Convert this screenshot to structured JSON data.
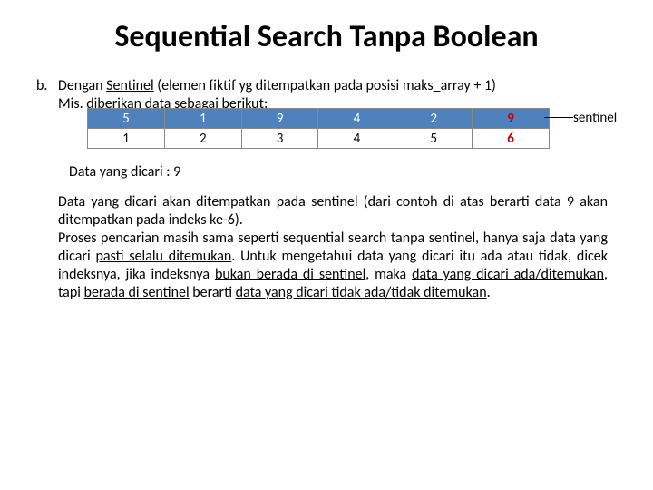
{
  "title": "Sequential Search Tanpa Boolean",
  "list_marker": "b.",
  "intro_prefix": "Dengan ",
  "intro_sentinel": "Sentinel",
  "intro_rest": " (elemen fiktif yg ditempatkan pada posisi maks_array + 1)",
  "intro_line2": "Mis. diberikan data sebagai berikut:",
  "table": {
    "data": [
      "5",
      "1",
      "9",
      "4",
      "2",
      "9"
    ],
    "index": [
      "1",
      "2",
      "3",
      "4",
      "5",
      "6"
    ]
  },
  "sentinel_label": "sentinel",
  "search_label": "Data yang dicari : 9",
  "para1_a": "Data yang dicari akan ditempatkan pada sentinel (dari contoh di atas berarti data 9 akan ditempatkan pada indeks ke-6).",
  "para2_a": "Proses pencarian masih sama seperti sequential search tanpa sentinel, hanya saja data yang dicari ",
  "para2_b": "pasti selalu ditemukan",
  "para2_c": ". Untuk mengetahui data yang dicari itu ada atau tidak, dicek indeksnya, jika indeksnya ",
  "para2_d": "bukan berada di sentinel",
  "para2_e": ", maka ",
  "para2_f": "data yang dicari ada/ditemukan",
  "para2_g": ", tapi ",
  "para2_h": "berada di sentinel",
  "para2_i": " berarti ",
  "para2_j": "data yang dicari tidak ada/tidak ditemukan",
  "para2_k": "."
}
